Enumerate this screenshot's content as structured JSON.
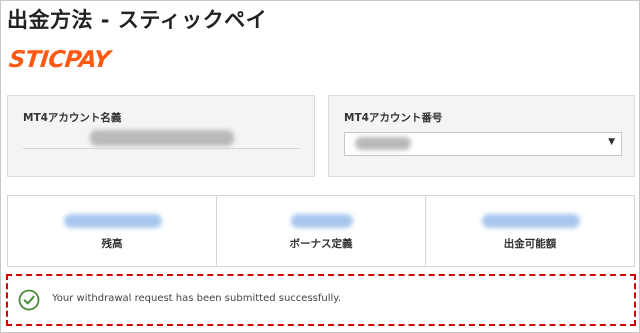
{
  "page": {
    "title": "出金方法 - スティックペイ",
    "brand": "STICPAY"
  },
  "account": {
    "name_label": "MT4アカウント名義",
    "number_label": "MT4アカウント番号"
  },
  "stats": [
    {
      "label": "残高"
    },
    {
      "label": "ボーナス定義"
    },
    {
      "label": "出金可能額"
    }
  ],
  "notice": {
    "message": "Your withdrawal request has been submitted successfully."
  },
  "colors": {
    "brand": "#ff5a14",
    "notice_border": "#d00000",
    "success_icon": "#4a8a3a"
  }
}
